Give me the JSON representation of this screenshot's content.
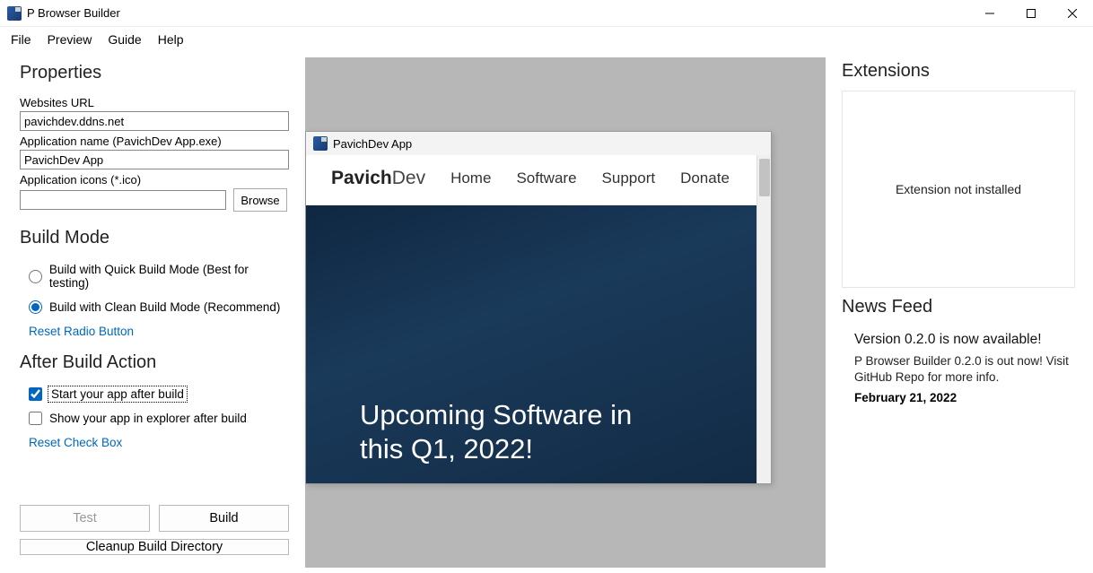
{
  "window": {
    "title": "P Browser Builder"
  },
  "menu": [
    "File",
    "Preview",
    "Guide",
    "Help"
  ],
  "properties": {
    "heading": "Properties",
    "url_label": "Websites URL",
    "url_value": "pavichdev.ddns.net",
    "appname_label": "Application name (PavichDev App.exe)",
    "appname_value": "PavichDev App",
    "icon_label": "Application icons (*.ico)",
    "icon_value": "",
    "browse": "Browse"
  },
  "build_mode": {
    "heading": "Build Mode",
    "quick": "Build with Quick Build Mode (Best for testing)",
    "clean": "Build with Clean Build Mode (Recommend)",
    "reset": "Reset Radio Button"
  },
  "after_build": {
    "heading": "After Build Action",
    "start": "Start your app after build",
    "explorer": "Show your app in explorer after build",
    "reset": "Reset Check Box"
  },
  "buttons": {
    "test": "Test",
    "build": "Build",
    "cleanup": "Cleanup Build Directory"
  },
  "preview": {
    "title": "PavichDev App",
    "brand_bold": "Pavich",
    "brand_light": "Dev",
    "nav": [
      "Home",
      "Software",
      "Support",
      "Donate"
    ],
    "hero_line1": "Upcoming Software in",
    "hero_line2": "this Q1, 2022!"
  },
  "extensions": {
    "heading": "Extensions",
    "empty": "Extension not installed"
  },
  "news": {
    "heading": "News Feed",
    "items": [
      {
        "title": "Version 0.2.0 is now available!",
        "body": "P Browser Builder 0.2.0 is out now! Visit GitHub Repo for more info.",
        "date": "February 21, 2022"
      }
    ]
  }
}
